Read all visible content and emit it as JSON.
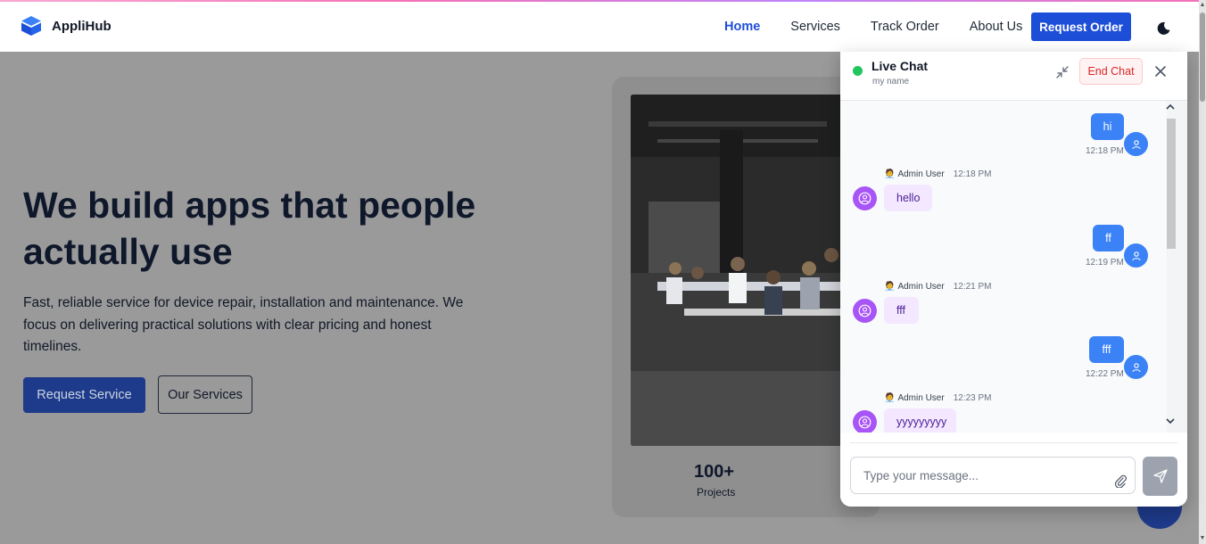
{
  "nav": {
    "brand": "AppliHub",
    "links": [
      "Home",
      "Services",
      "Track Order",
      "About Us"
    ],
    "request_order": "Request Order"
  },
  "hero": {
    "title": "We build apps that people actually use",
    "description": "Fast, reliable service for device repair, installation and maintenance. We focus on delivering practical solutions with clear pricing and honest timelines.",
    "primary_button": "Request Service",
    "secondary_button": "Our Services"
  },
  "stats": {
    "value": "100+",
    "label": "Projects"
  },
  "chat": {
    "title": "Live Chat",
    "subtitle": "my name",
    "end_chat": "End Chat",
    "messages": [
      {
        "from": "user",
        "text": "hi",
        "time": "12:18 PM"
      },
      {
        "from": "admin",
        "sender": "Admin User",
        "text": "hello",
        "time": "12:18 PM"
      },
      {
        "from": "user",
        "text": "ff",
        "time": "12:19 PM"
      },
      {
        "from": "admin",
        "sender": "Admin User",
        "text": "fff",
        "time": "12:21 PM"
      },
      {
        "from": "user",
        "text": "fff",
        "time": "12:22 PM"
      },
      {
        "from": "admin",
        "sender": "Admin User",
        "text": "yyyyyyyyy",
        "time": "12:23 PM"
      }
    ],
    "input_placeholder": "Type your message...",
    "admin_emoji": "🧑‍💼"
  },
  "colors": {
    "primary": "#1d4ed8",
    "user_bubble": "#3b82f6",
    "admin_bubble": "#f3e8ff",
    "admin_avatar": "#a855f7",
    "online": "#22c55e",
    "end_chat": "#dc2626"
  }
}
